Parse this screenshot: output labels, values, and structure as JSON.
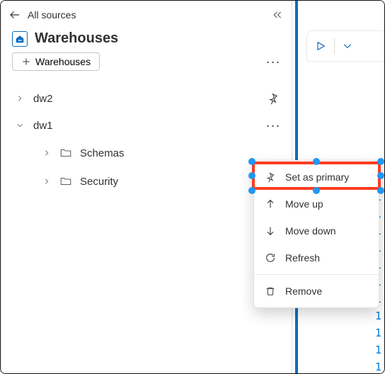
{
  "header": {
    "back_label": "All sources",
    "title": "Warehouses"
  },
  "toolbar": {
    "add_label": "Warehouses"
  },
  "tree": {
    "items": [
      {
        "label": "dw2",
        "expanded": false,
        "action": "pin"
      },
      {
        "label": "dw1",
        "expanded": true,
        "action": "more",
        "children": [
          {
            "label": "Schemas"
          },
          {
            "label": "Security"
          }
        ]
      }
    ]
  },
  "context_menu": {
    "items": [
      {
        "icon": "pin-icon",
        "label": "Set as primary"
      },
      {
        "icon": "arrow-up-icon",
        "label": "Move up"
      },
      {
        "icon": "arrow-down-icon",
        "label": "Move down"
      },
      {
        "icon": "refresh-icon",
        "label": "Refresh"
      },
      {
        "icon": "trash-icon",
        "label": "Remove"
      }
    ]
  },
  "line_numbers": [
    "1",
    "1",
    "1",
    "1",
    "1",
    "1",
    "1",
    "1",
    "1",
    "1",
    "1"
  ],
  "colors": {
    "accent": "#0f6cbd",
    "highlight": "#ff3b1f"
  }
}
